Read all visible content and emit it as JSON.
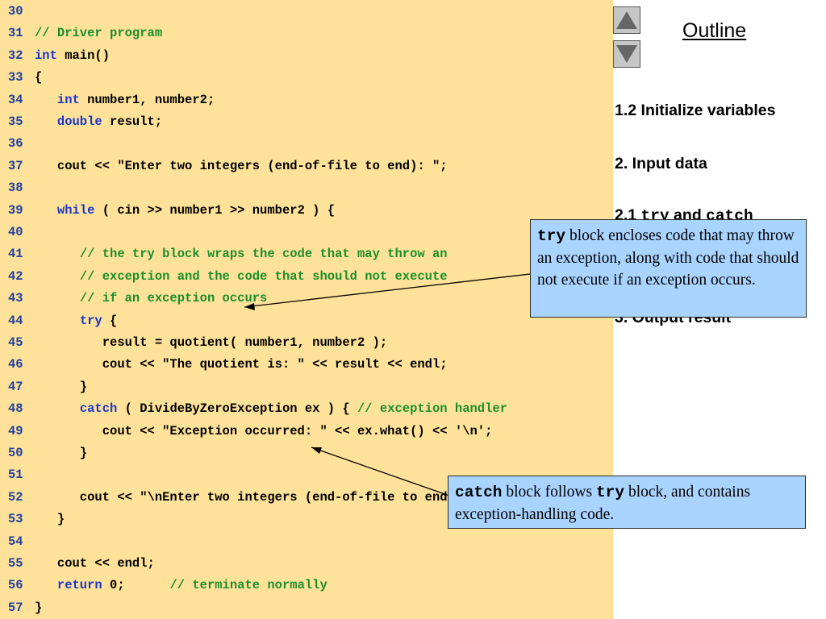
{
  "code": {
    "lines": [
      {
        "no": "30",
        "segs": []
      },
      {
        "no": "31",
        "segs": [
          {
            "t": "// Driver program",
            "c": "cm"
          }
        ]
      },
      {
        "no": "32",
        "segs": [
          {
            "t": "int",
            "c": "kw"
          },
          {
            "t": " main()",
            "c": ""
          }
        ]
      },
      {
        "no": "33",
        "segs": [
          {
            "t": "{",
            "c": ""
          }
        ]
      },
      {
        "no": "34",
        "segs": [
          {
            "t": "   ",
            "c": ""
          },
          {
            "t": "int",
            "c": "kw"
          },
          {
            "t": " number1, number2;",
            "c": ""
          }
        ]
      },
      {
        "no": "35",
        "segs": [
          {
            "t": "   ",
            "c": ""
          },
          {
            "t": "double",
            "c": "kw"
          },
          {
            "t": " result;",
            "c": ""
          }
        ]
      },
      {
        "no": "36",
        "segs": []
      },
      {
        "no": "37",
        "segs": [
          {
            "t": "   cout << \"Enter two integers (end-of-file to end): \";",
            "c": ""
          }
        ]
      },
      {
        "no": "38",
        "segs": []
      },
      {
        "no": "39",
        "segs": [
          {
            "t": "   ",
            "c": ""
          },
          {
            "t": "while",
            "c": "kw"
          },
          {
            "t": " ( cin >> number1 >> number2 ) {",
            "c": ""
          }
        ]
      },
      {
        "no": "40",
        "segs": []
      },
      {
        "no": "41",
        "segs": [
          {
            "t": "      ",
            "c": ""
          },
          {
            "t": "// the try block wraps the code that may throw an",
            "c": "cm"
          }
        ]
      },
      {
        "no": "42",
        "segs": [
          {
            "t": "      ",
            "c": ""
          },
          {
            "t": "// exception and the code that should not execute",
            "c": "cm"
          }
        ]
      },
      {
        "no": "43",
        "segs": [
          {
            "t": "      ",
            "c": ""
          },
          {
            "t": "// if an exception occurs",
            "c": "cm"
          }
        ]
      },
      {
        "no": "44",
        "segs": [
          {
            "t": "      ",
            "c": ""
          },
          {
            "t": "try",
            "c": "kw"
          },
          {
            "t": " {",
            "c": ""
          }
        ]
      },
      {
        "no": "45",
        "segs": [
          {
            "t": "         result = quotient( number1, number2 );",
            "c": ""
          }
        ]
      },
      {
        "no": "46",
        "segs": [
          {
            "t": "         cout << \"The quotient is: \" << result << endl;",
            "c": ""
          }
        ]
      },
      {
        "no": "47",
        "segs": [
          {
            "t": "      }",
            "c": ""
          }
        ]
      },
      {
        "no": "48",
        "segs": [
          {
            "t": "      ",
            "c": ""
          },
          {
            "t": "catch",
            "c": "kw"
          },
          {
            "t": " ( DivideByZeroException ex ) { ",
            "c": ""
          },
          {
            "t": "// exception handler",
            "c": "cm"
          }
        ]
      },
      {
        "no": "49",
        "segs": [
          {
            "t": "         cout << \"Exception occurred: \" << ex.what() << '\\n';",
            "c": ""
          }
        ]
      },
      {
        "no": "50",
        "segs": [
          {
            "t": "      }",
            "c": ""
          }
        ]
      },
      {
        "no": "51",
        "segs": []
      },
      {
        "no": "52",
        "segs": [
          {
            "t": "      cout << \"\\nEnter two integers (end-of-file to end): \";",
            "c": ""
          }
        ]
      },
      {
        "no": "53",
        "segs": [
          {
            "t": "   }",
            "c": ""
          }
        ]
      },
      {
        "no": "54",
        "segs": []
      },
      {
        "no": "55",
        "segs": [
          {
            "t": "   cout << endl;",
            "c": ""
          }
        ]
      },
      {
        "no": "56",
        "segs": [
          {
            "t": "   ",
            "c": ""
          },
          {
            "t": "return",
            "c": "kw"
          },
          {
            "t": " 0;      ",
            "c": ""
          },
          {
            "t": "// terminate normally",
            "c": "cm"
          }
        ]
      },
      {
        "no": "57",
        "segs": [
          {
            "t": "}",
            "c": ""
          }
        ]
      }
    ]
  },
  "nav": {
    "up_icon": "triangle-up-icon",
    "down_icon": "triangle-down-icon"
  },
  "outline": {
    "title": "Outline",
    "item1": "1.2 Initialize variables",
    "item2": "2. Input data",
    "item3_prefix": "2.1 ",
    "item3_try": "try",
    "item3_and": " and ",
    "item3_catch": "catch",
    "item4": "3. Output result"
  },
  "callouts": {
    "try": {
      "code": "try",
      "text": " block encloses code that may throw an exception, along with code that should not execute if an exception occurs."
    },
    "catch": {
      "code1": "catch",
      "text1": " block follows ",
      "code2": "try",
      "text2": " block, and contains exception-handling code."
    }
  },
  "colors": {
    "code_bg": "#ffe29a",
    "callout_bg": "#a9d4ff",
    "keyword": "#1a35c9",
    "comment": "#1b8e2a",
    "line_number": "#1f3f9e"
  }
}
